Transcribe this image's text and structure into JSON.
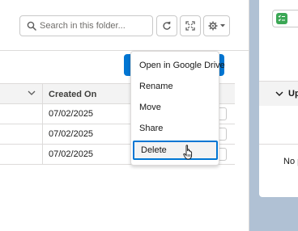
{
  "toolbar": {
    "search_placeholder": "Search in this folder..."
  },
  "table": {
    "column_header": "Created On",
    "rows": [
      {
        "created_on": "07/02/2025"
      },
      {
        "created_on": "07/02/2025"
      },
      {
        "created_on": "07/02/2025"
      }
    ]
  },
  "menu": {
    "items": [
      {
        "label": "Open in Google Drive"
      },
      {
        "label": "Rename"
      },
      {
        "label": "Move"
      },
      {
        "label": "Share"
      },
      {
        "label": "Delete"
      }
    ],
    "active_item": "Delete"
  },
  "right_panel": {
    "section_title": "Up",
    "empty_text": "No p"
  },
  "colors": {
    "accent": "#0176d3",
    "background": "#b0c1d4",
    "icon_green": "#3ba755"
  }
}
